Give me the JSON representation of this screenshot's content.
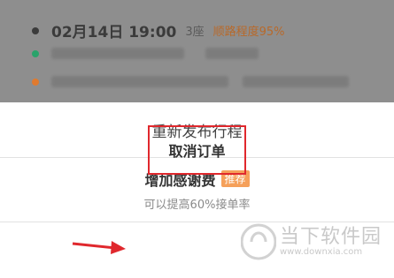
{
  "background_card": {
    "time": "02月14日 19:00",
    "seats": "3座",
    "match": "顺路程度95%"
  },
  "sheet": {
    "republish_label": "重新发布行程",
    "add_tip_label": "增加感谢费",
    "add_tip_badge": "推荐",
    "add_tip_sub": "可以提高60%接单率",
    "cancel_label": "取消订单"
  },
  "watermark": {
    "text": "当下软件园",
    "url": "www.downxia.com"
  },
  "colors": {
    "accent": "#e0282d",
    "badge": "#f5a05a",
    "match": "#b8692a",
    "dot_start": "#29a36a",
    "dot_end": "#e07a2e"
  }
}
